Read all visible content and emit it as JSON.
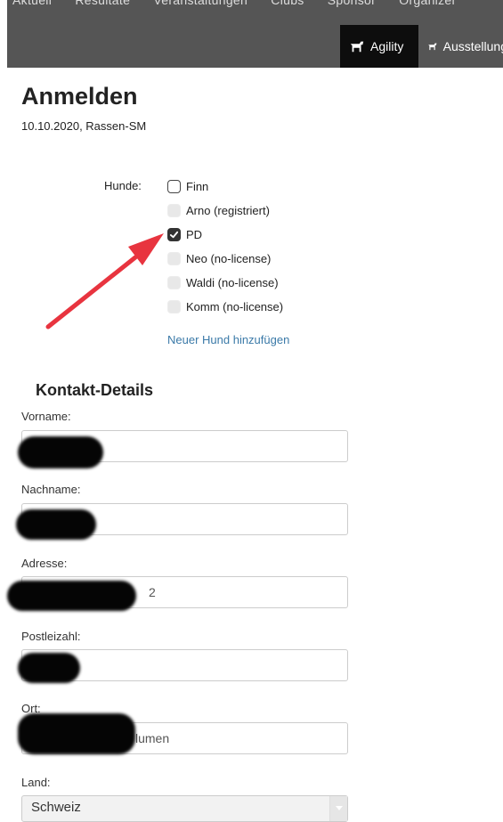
{
  "header": {
    "menu": [
      "Aktuell",
      "Resultate",
      "Veranstaltungen",
      "Clubs",
      "Sponsor",
      "Organizer"
    ],
    "tabs": [
      {
        "label": "Agility",
        "active": true
      },
      {
        "label": "Ausstellung",
        "active": false
      }
    ]
  },
  "page": {
    "title": "Anmelden",
    "subtitle": "10.10.2020, Rassen-SM"
  },
  "dogs": {
    "label": "Hunde:",
    "items": [
      {
        "name": "Finn",
        "state": "enabled"
      },
      {
        "name": "Arno (registriert)",
        "state": "disabled"
      },
      {
        "name": "PD",
        "state": "checked"
      },
      {
        "name": "Neo (no-license)",
        "state": "disabled"
      },
      {
        "name": "Waldi (no-license)",
        "state": "disabled"
      },
      {
        "name": "Komm (no-license)",
        "state": "disabled"
      }
    ],
    "add_link": "Neuer Hund hinzufügen"
  },
  "contact": {
    "heading": "Kontakt-Details",
    "vorname_label": "Vorname:",
    "nachname_label": "Nachname:",
    "adresse_label": "Adresse:",
    "adresse_value_partial": "2",
    "plz_label": "Postleizahl:",
    "ort_label": "Ort:",
    "ort_value_partial": "lumen",
    "land_label": "Land:",
    "land_value": "Schweiz"
  },
  "colors": {
    "header_bg": "#555555",
    "active_tab_bg": "#0d0d0d",
    "link": "#3b7aa8",
    "arrow": "#e8343f"
  }
}
